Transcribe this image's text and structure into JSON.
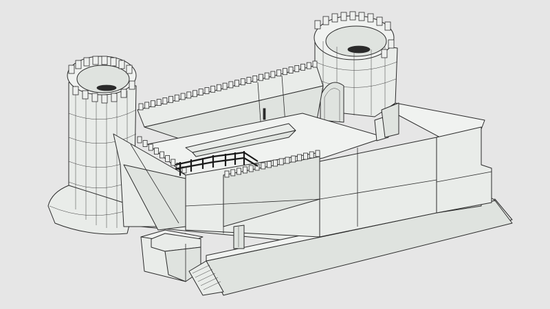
{
  "scene": {
    "background_color": "#e6e6e6",
    "wall_fill_color": "#e9ece9",
    "line_color": "#2a2a2a"
  }
}
